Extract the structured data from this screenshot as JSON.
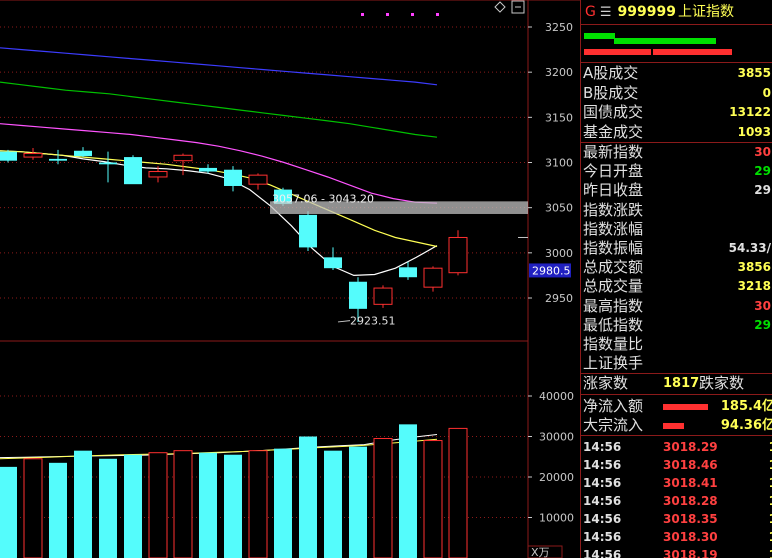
{
  "colors": {
    "up": "#ff3030",
    "down": "#54fcfc",
    "ma5": "#ffffff",
    "ma10": "#ffff54",
    "ma20": "#ff54ff",
    "ma60": "#00c000",
    "ma120": "#3c3cff",
    "grid": "#8b1a1a",
    "highlight": "#2020c0"
  },
  "chart_data": {
    "type": "candlestick",
    "price_axis": {
      "ticks": [
        3250,
        3200,
        3150,
        3100,
        3050,
        3000,
        2950
      ]
    },
    "volume_axis": {
      "ticks": [
        40000,
        30000,
        20000,
        10000
      ],
      "unit_label": "X万"
    },
    "current_price_label": "2980.5",
    "zoom_box_label": "3057.06 - 3043.20",
    "low_annotation": "2923.51",
    "candles": [
      {
        "o": 3112,
        "h": 3114,
        "l": 3100,
        "c": 3102,
        "vol": 22500
      },
      {
        "o": 3106,
        "h": 3116,
        "l": 3103,
        "c": 3110,
        "vol": 24500
      },
      {
        "o": 3104,
        "h": 3114,
        "l": 3098,
        "c": 3102,
        "vol": 23500
      },
      {
        "o": 3113,
        "h": 3117,
        "l": 3106,
        "c": 3107,
        "vol": 26500
      },
      {
        "o": 3100,
        "h": 3112,
        "l": 3078,
        "c": 3098,
        "vol": 24500
      },
      {
        "o": 3106,
        "h": 3108,
        "l": 3080,
        "c": 3076,
        "vol": 25500
      },
      {
        "o": 3084,
        "h": 3096,
        "l": 3078,
        "c": 3090,
        "vol": 26000
      },
      {
        "o": 3102,
        "h": 3110,
        "l": 3086,
        "c": 3108,
        "vol": 26500
      },
      {
        "o": 3094,
        "h": 3098,
        "l": 3088,
        "c": 3090,
        "vol": 26000
      },
      {
        "o": 3092,
        "h": 3096,
        "l": 3068,
        "c": 3074,
        "vol": 25500
      },
      {
        "o": 3076,
        "h": 3088,
        "l": 3070,
        "c": 3086,
        "vol": 26500
      },
      {
        "o": 3070,
        "h": 3072,
        "l": 3052,
        "c": 3054,
        "vol": 27000
      },
      {
        "o": 3042,
        "h": 3046,
        "l": 3002,
        "c": 3006,
        "vol": 30000
      },
      {
        "o": 2995,
        "h": 3006,
        "l": 2981,
        "c": 2983,
        "vol": 26500
      },
      {
        "o": 2968,
        "h": 2973,
        "l": 2923.5,
        "c": 2938,
        "vol": 27500
      },
      {
        "o": 2943,
        "h": 2964,
        "l": 2939,
        "c": 2961,
        "vol": 29500
      },
      {
        "o": 2984,
        "h": 2990,
        "l": 2970,
        "c": 2973,
        "vol": 33000
      },
      {
        "o": 2962,
        "h": 2985,
        "l": 2957,
        "c": 2983,
        "vol": 29000
      },
      {
        "o": 2978,
        "h": 3025,
        "l": 2975,
        "c": 3017,
        "vol": 32000
      }
    ],
    "ma_series": [
      {
        "key": "ma5",
        "values": [
          3113,
          3112,
          3110,
          3108,
          3104,
          3101,
          3097,
          3094,
          3093,
          3091,
          3088,
          3082,
          3070,
          3052,
          3030,
          3005,
          2985,
          2975,
          2976,
          2983,
          2995,
          3008
        ]
      },
      {
        "key": "ma10",
        "values": [
          3113,
          3112,
          3110,
          3108,
          3106,
          3104,
          3102,
          3100,
          3098,
          3095,
          3092,
          3088,
          3083,
          3075,
          3065,
          3055,
          3045,
          3035,
          3025,
          3017,
          3012,
          3007
        ]
      },
      {
        "key": "ma20",
        "values": [
          3143,
          3141,
          3139,
          3137,
          3135,
          3133,
          3131,
          3128,
          3125,
          3122,
          3118,
          3113,
          3107,
          3100,
          3092,
          3084,
          3075,
          3066,
          3060,
          3056,
          3055
        ]
      },
      {
        "key": "ma60",
        "values": [
          3189,
          3186,
          3183,
          3180,
          3178,
          3176,
          3173,
          3170,
          3167,
          3164,
          3161,
          3158,
          3155,
          3152,
          3149,
          3146,
          3143,
          3139,
          3135,
          3131,
          3128
        ]
      },
      {
        "key": "ma120",
        "values": [
          3227,
          3225,
          3223,
          3221,
          3219,
          3217,
          3215,
          3213,
          3211,
          3209,
          3207,
          3205,
          3203,
          3201,
          3199,
          3197,
          3195,
          3193,
          3191,
          3189,
          3186
        ]
      }
    ],
    "volume_ma": [
      {
        "key": "ma5",
        "values": [
          24800,
          24900,
          25000,
          25100,
          25200,
          25300,
          25400,
          25600,
          25800,
          26000,
          26300,
          26600,
          27000,
          27400,
          27700,
          28000,
          29000,
          29800,
          30500
        ]
      },
      {
        "key": "ma10",
        "values": [
          24500,
          24700,
          24900,
          25100,
          25300,
          25500,
          25600,
          25700,
          25900,
          26100,
          26300,
          26600,
          26900,
          27200,
          27500,
          27800,
          28300,
          28800,
          29300
        ]
      }
    ]
  },
  "header": {
    "g_label": "G",
    "menu_icon": "hamburger-icon",
    "code": "999999",
    "name": "上证指数"
  },
  "top_bars": [
    {
      "color": "#00e000",
      "width_pct": 0.16
    },
    {
      "color": "#00e000",
      "width_pct": 0.53
    },
    {
      "color": "#ff3030",
      "width_pct": 0.35
    },
    {
      "color": "#ff3030",
      "width_pct": 0.41
    }
  ],
  "stats_group1": [
    {
      "label": "A股成交",
      "value": "3855",
      "color": "#ffff55"
    },
    {
      "label": "B股成交",
      "value": "0",
      "color": "#ffff55"
    },
    {
      "label": "国债成交",
      "value": "13122",
      "color": "#ffff55"
    },
    {
      "label": "基金成交",
      "value": "1093",
      "color": "#ffff55"
    }
  ],
  "stats_group2": [
    {
      "label": "最新指数",
      "value": "30",
      "color": "#ff4040"
    },
    {
      "label": "今日开盘",
      "value": "29",
      "color": "#00e000"
    },
    {
      "label": "昨日收盘",
      "value": "29",
      "color": "#e0e0e0"
    },
    {
      "label": "指数涨跌",
      "value": "",
      "color": "#ff4040"
    },
    {
      "label": "指数涨幅",
      "value": "",
      "color": "#ff4040"
    },
    {
      "label": "指数振幅",
      "value": "54.33/",
      "color": "#e0e0e0"
    },
    {
      "label": "总成交额",
      "value": "3856",
      "color": "#ffff55"
    },
    {
      "label": "总成交量",
      "value": "3218",
      "color": "#ffff55"
    },
    {
      "label": "最高指数",
      "value": "30",
      "color": "#ff4040"
    },
    {
      "label": "最低指数",
      "value": "29",
      "color": "#00e000"
    },
    {
      "label": "指数量比",
      "value": "",
      "color": "#e0e0e0"
    },
    {
      "label": "上证换手",
      "value": "",
      "color": "#e0e0e0"
    }
  ],
  "breadth": {
    "up_label": "涨家数",
    "up_value": "1817",
    "down_label": "跌家数"
  },
  "flows": [
    {
      "label": "净流入额",
      "value": "185.4亿",
      "bar_pct": 0.6
    },
    {
      "label": "大宗流入",
      "value": "94.36亿",
      "bar_pct": 0.28
    }
  ],
  "ticks": [
    {
      "time": "14:56",
      "price": "3018.29",
      "vol": "1"
    },
    {
      "time": "14:56",
      "price": "3018.46",
      "vol": "1"
    },
    {
      "time": "14:56",
      "price": "3018.41",
      "vol": "1"
    },
    {
      "time": "14:56",
      "price": "3018.28",
      "vol": "1"
    },
    {
      "time": "14:56",
      "price": "3018.35",
      "vol": "1"
    },
    {
      "time": "14:56",
      "price": "3018.30",
      "vol": "1"
    },
    {
      "time": "14:56",
      "price": "3018.19",
      "vol": "1"
    }
  ]
}
